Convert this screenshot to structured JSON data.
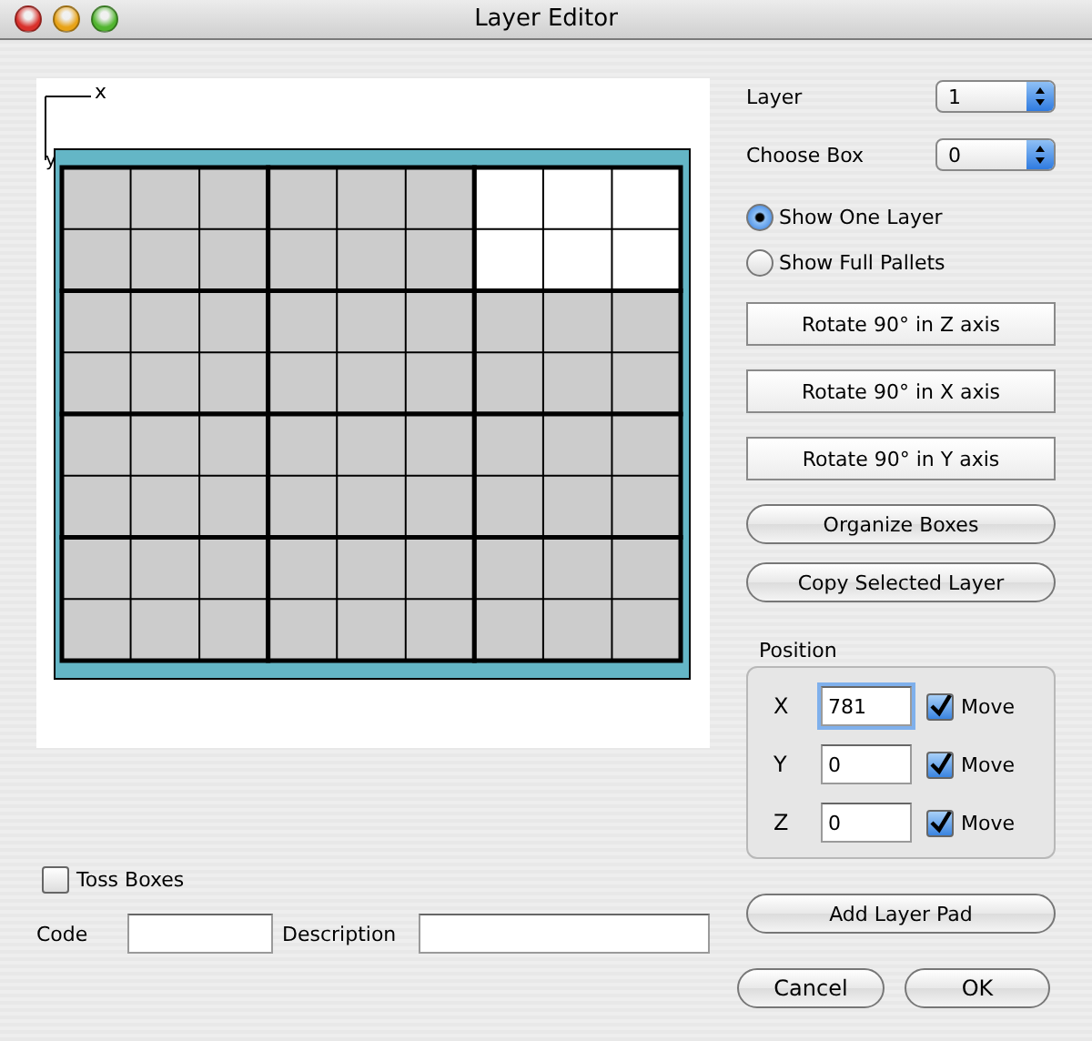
{
  "window": {
    "title": "Layer Editor"
  },
  "canvas": {
    "x_axis_label": "x",
    "y_axis_label": "y",
    "boxes": [
      {
        "selected": false
      },
      {
        "selected": false
      },
      {
        "selected": true
      },
      {
        "selected": false
      },
      {
        "selected": false
      },
      {
        "selected": false
      },
      {
        "selected": false
      },
      {
        "selected": false
      },
      {
        "selected": false
      },
      {
        "selected": false
      },
      {
        "selected": false
      },
      {
        "selected": false
      }
    ]
  },
  "toss_boxes": {
    "label": "Toss Boxes",
    "checked": false
  },
  "code": {
    "label": "Code"
  },
  "description": {
    "label": "Description"
  },
  "layer": {
    "label": "Layer",
    "value": "1"
  },
  "choose_box": {
    "label": "Choose Box",
    "value": "0"
  },
  "view_options": [
    {
      "label": "Show One Layer",
      "selected": true
    },
    {
      "label": "Show Full Pallets",
      "selected": false
    }
  ],
  "rotate_buttons": [
    "Rotate 90° in Z axis",
    "Rotate 90° in X axis",
    "Rotate 90° in Y axis"
  ],
  "action_buttons": [
    "Organize Boxes",
    "Copy Selected Layer"
  ],
  "position": {
    "title": "Position",
    "axes": [
      {
        "label": "X",
        "value": "781",
        "focused": true,
        "move_label": "Move",
        "move": true
      },
      {
        "label": "Y",
        "value": "0",
        "focused": false,
        "move_label": "Move",
        "move": true
      },
      {
        "label": "Z",
        "value": "0",
        "focused": false,
        "move_label": "Move",
        "move": true
      }
    ]
  },
  "add_layer_pad": "Add Layer Pad",
  "buttons": {
    "cancel": "Cancel",
    "ok": "OK"
  }
}
